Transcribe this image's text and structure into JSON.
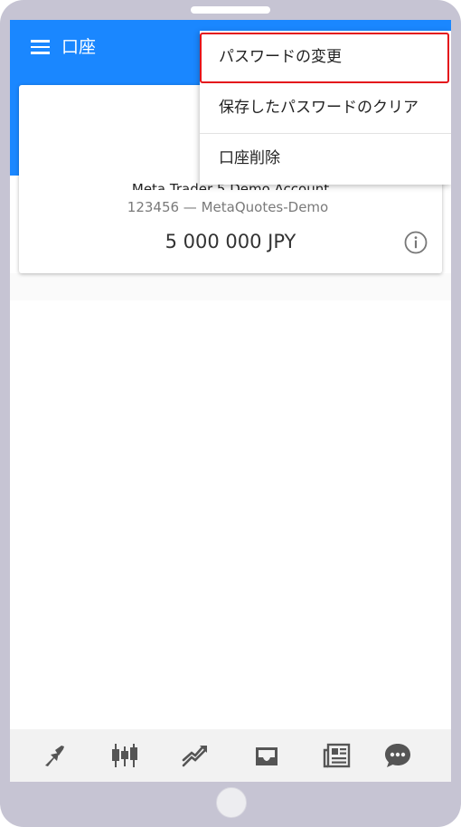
{
  "app": {
    "title": "口座"
  },
  "account": {
    "name": "Meta Trader 5 Demo Account",
    "server": "123456 — MetaQuotes-Demo",
    "balance": "5 000 000 JPY"
  },
  "menu": {
    "items": [
      {
        "label": "パスワードの変更",
        "highlighted": true
      },
      {
        "label": "保存したパスワードのクリア"
      },
      {
        "label": "口座削除"
      }
    ]
  },
  "bottom_nav": {
    "items": [
      {
        "icon": "quotes-arrows-icon"
      },
      {
        "icon": "candlestick-chart-icon"
      },
      {
        "icon": "trade-line-icon"
      },
      {
        "icon": "inbox-icon"
      },
      {
        "icon": "news-icon"
      },
      {
        "icon": "chat-bubble-icon"
      }
    ]
  },
  "colors": {
    "appbar": "#1a87ff",
    "highlight": "#e4141b",
    "frame": "#c6c4d3",
    "icon": "#555555"
  }
}
